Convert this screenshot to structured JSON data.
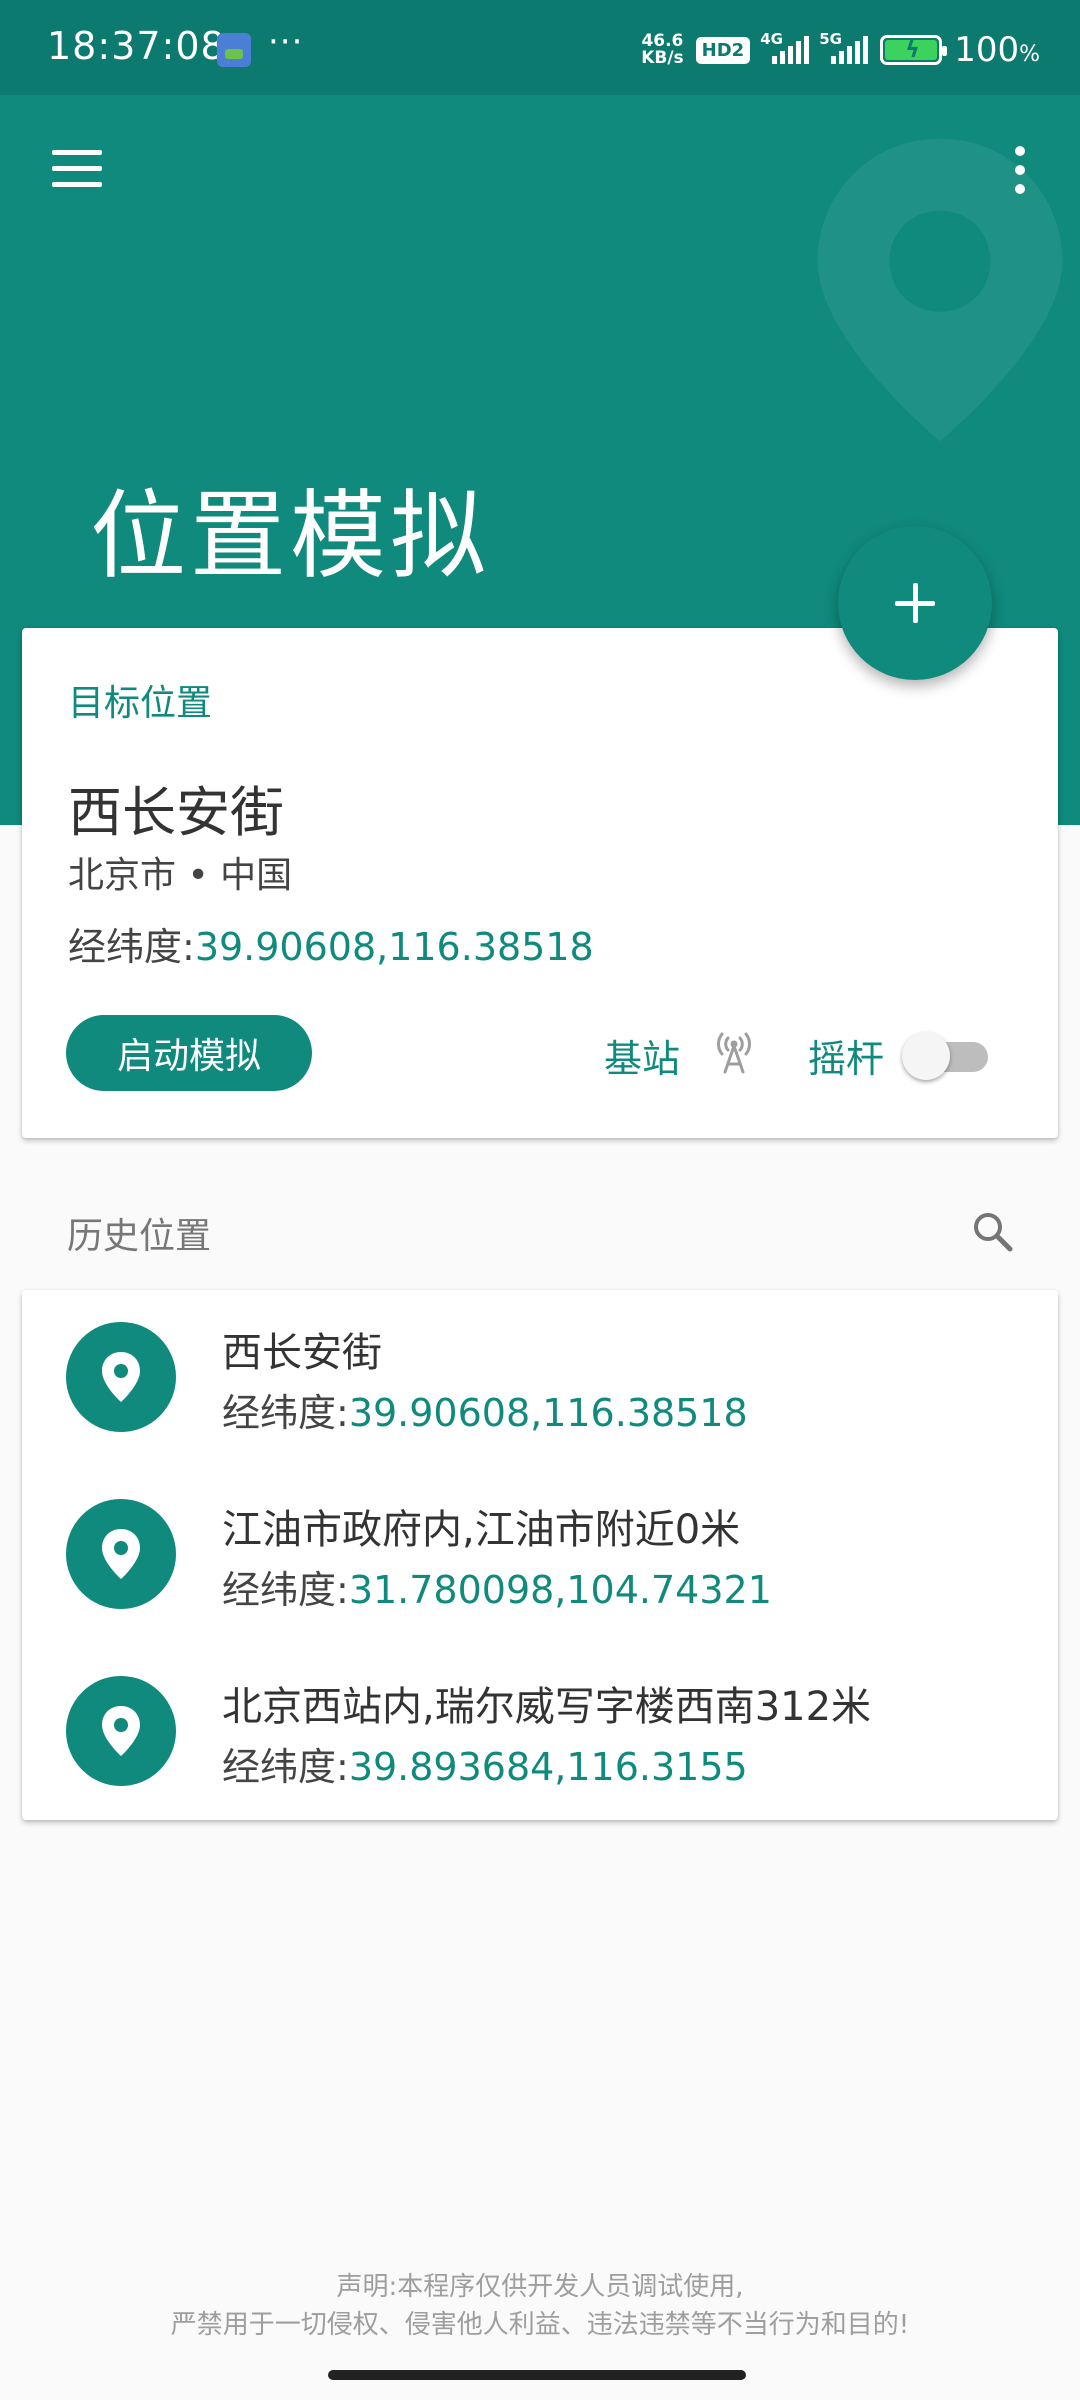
{
  "status_bar": {
    "time": "18:37:08",
    "more": "···",
    "net_speed_value": "46.6",
    "net_speed_unit": "KB/s",
    "hd_badge": "HD2",
    "signal1_label": "4G",
    "signal2_label": "5G",
    "battery_value": "100",
    "battery_unit": "%"
  },
  "header": {
    "title": "位置模拟"
  },
  "target_card": {
    "label": "目标位置",
    "place_name": "西长安街",
    "region": "北京市 • 中国",
    "coords_label": "经纬度:",
    "coords_value": "39.90608,116.38518",
    "start_button": "启动模拟",
    "station_label": "基站",
    "joystick_label": "摇杆",
    "joystick_enabled": false
  },
  "history": {
    "title": "历史位置",
    "items": [
      {
        "name": "西长安街",
        "coords_label": "经纬度:",
        "coords_value": "39.90608,116.38518"
      },
      {
        "name": "江油市政府内,江油市附近0米",
        "coords_label": "经纬度:",
        "coords_value": "31.780098,104.74321"
      },
      {
        "name": "北京西站内,瑞尔威写字楼西南312米",
        "coords_label": "经纬度:",
        "coords_value": "39.893684,116.3155"
      }
    ]
  },
  "disclaimer": {
    "line1": "声明:本程序仅供开发人员调试使用,",
    "line2": "严禁用于一切侵权、侵害他人利益、违法违禁等不当行为和目的!"
  },
  "colors": {
    "primary": "#0f8a7c",
    "status_bar": "#0c7a6e",
    "background": "#fafafa"
  },
  "icons": [
    "menu-icon",
    "more-vert-icon",
    "add-icon",
    "antenna-icon",
    "search-icon",
    "location-pin-icon"
  ]
}
